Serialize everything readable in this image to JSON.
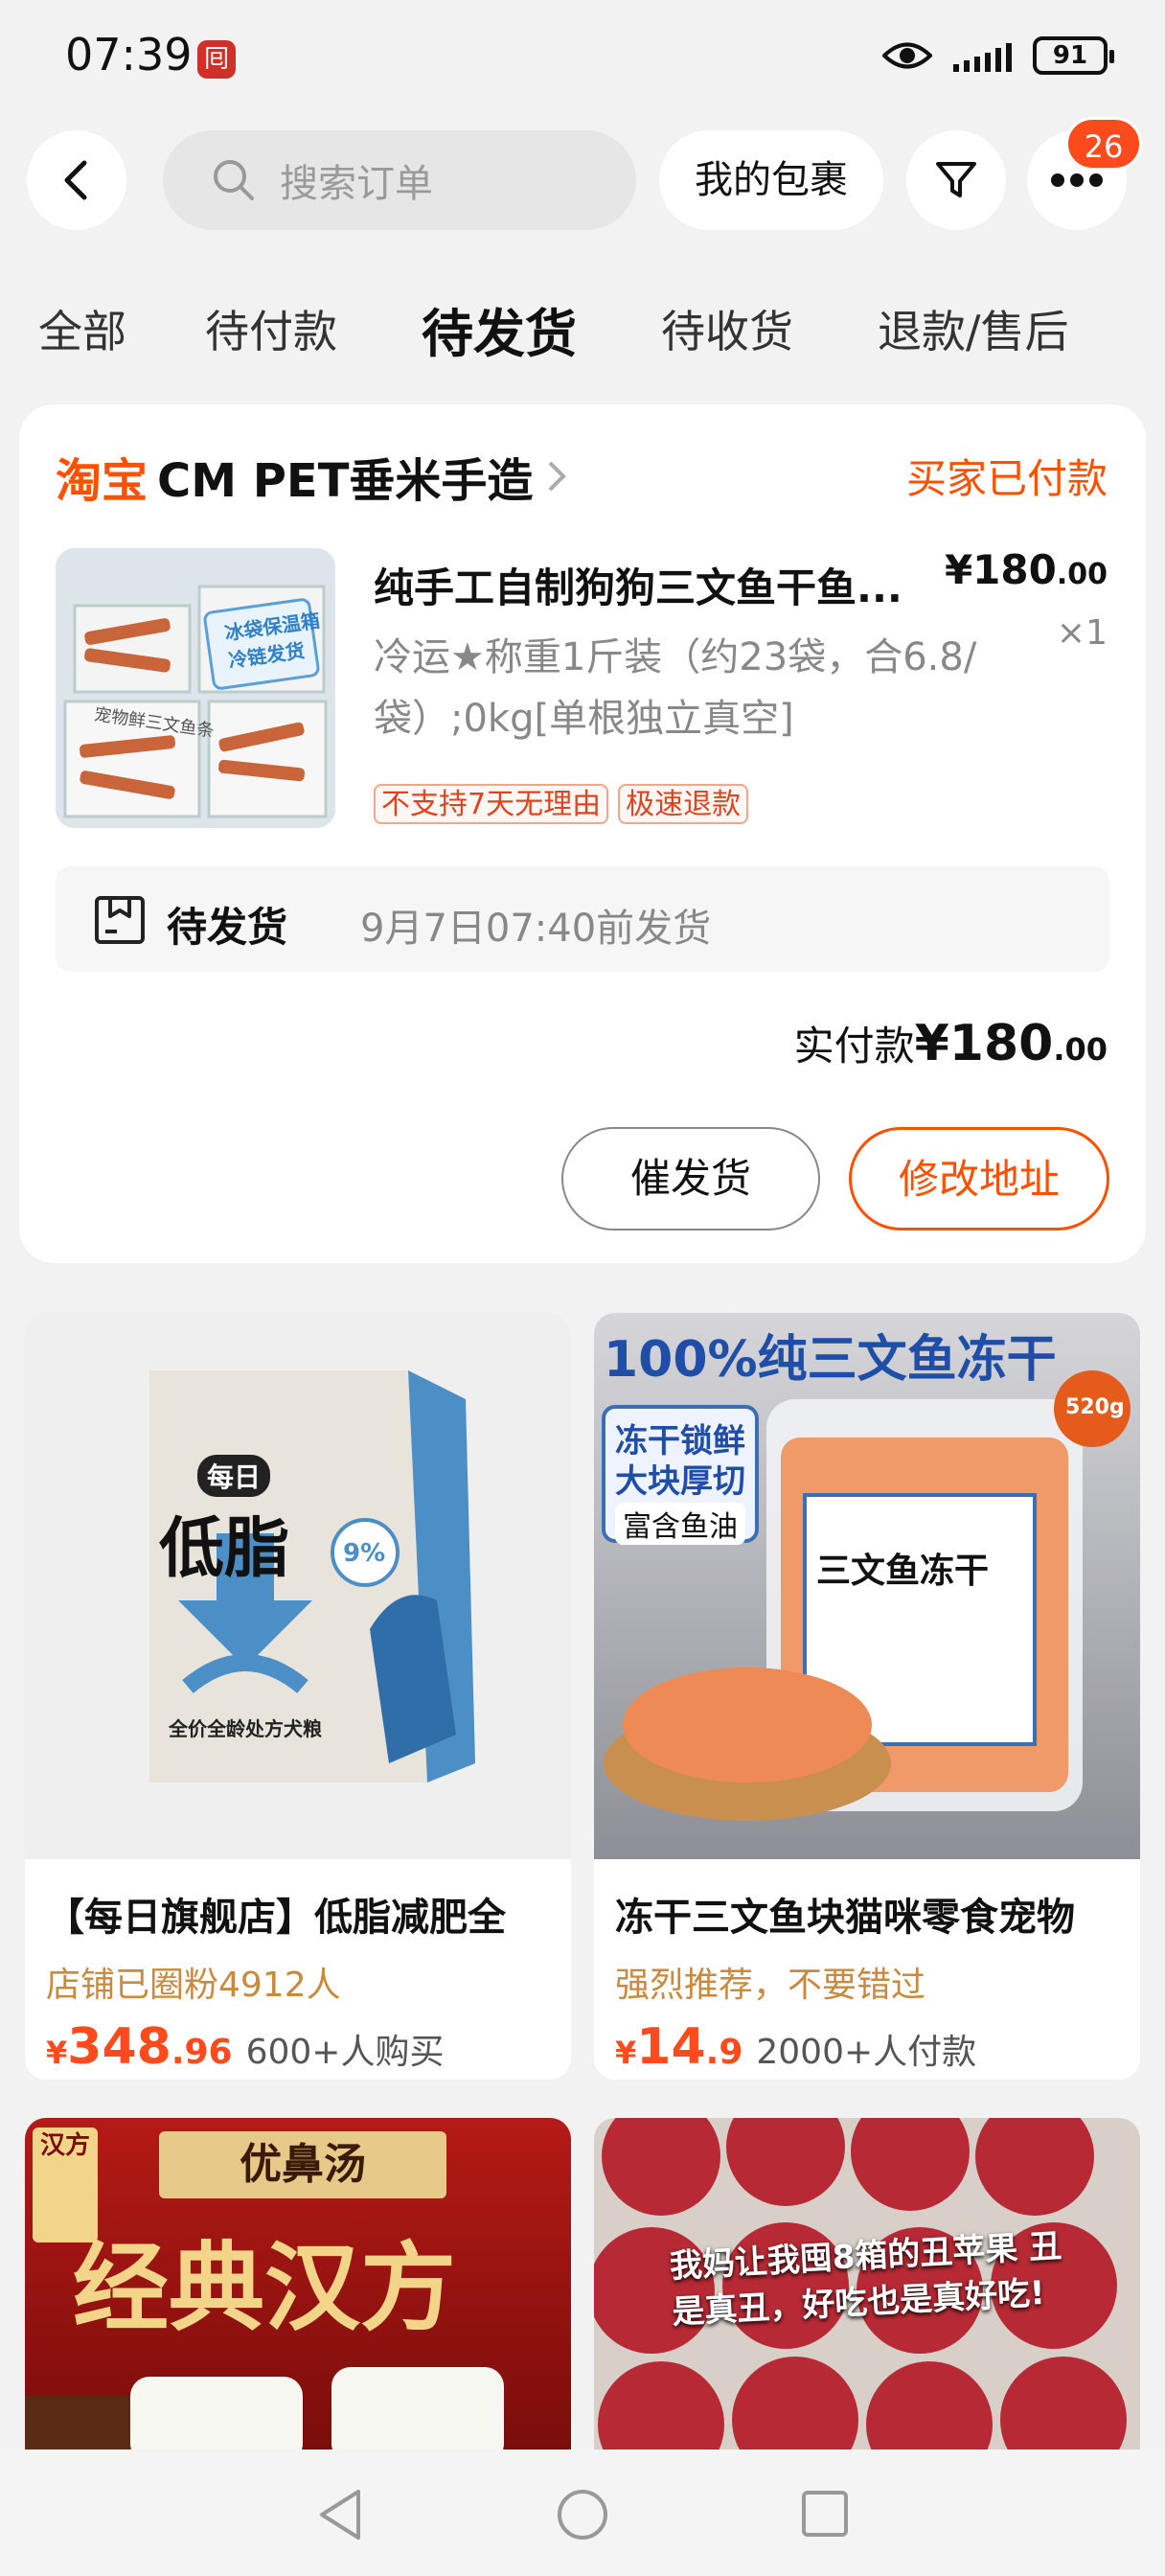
{
  "status_bar": {
    "time": "07:39",
    "app_icon_glyph": "囘",
    "battery": "91"
  },
  "header": {
    "search_placeholder": "搜索订单",
    "package_button": "我的包裹",
    "badge_count": "26"
  },
  "tabs": [
    {
      "label": "全部"
    },
    {
      "label": "待付款"
    },
    {
      "label": "待发货",
      "active": true
    },
    {
      "label": "待收货"
    },
    {
      "label": "退款/售后"
    }
  ],
  "order": {
    "platform": "淘宝",
    "shop_name": "CM PET垂米手造",
    "status": "买家已付款",
    "product_title": "纯手工自制狗狗三文鱼干鱼...",
    "price_int": "¥180",
    "price_dec": ".00",
    "quantity": "×1",
    "spec": "冷运★称重1斤装（约23袋，合6.8/袋）;0kg[单根独立真空]",
    "tags": [
      "不支持7天无理由",
      "极速退款"
    ],
    "image_text_1": "冰袋保温箱",
    "image_text_2": "冷链发货",
    "image_text_3": "宠物鲜三文鱼条",
    "ship_status": "待发货",
    "ship_time": "9月7日07:40前发货",
    "pay_label": "实付款",
    "pay_int": "¥180",
    "pay_dec": ".00",
    "btn_urge": "催发货",
    "btn_address": "修改地址"
  },
  "recommendations": [
    {
      "title": "【每日旗舰店】低脂减肥全",
      "subtitle": "店铺已圈粉4912人",
      "currency": "¥",
      "price_int": "348",
      "price_dec": ".96",
      "sold": "600+人购买",
      "img_brand": "每日",
      "img_main": "低脂",
      "img_pct": "9%",
      "img_caption": "全价全龄处方犬粮"
    },
    {
      "title": "冻干三文鱼块猫咪零食宠物",
      "subtitle": "强烈推荐，不要错过",
      "currency": "¥",
      "price_int": "14",
      "price_dec": ".9",
      "sold": "2000+人付款",
      "img_headline": "100%纯三文鱼冻干",
      "img_box1": "冻干锁鲜",
      "img_box2": "大块厚切",
      "img_box3": "富含鱼油",
      "img_label": "三文鱼冻干",
      "img_sticker": "520g"
    },
    {
      "img_banner": "优鼻汤",
      "img_main": "经典汉方",
      "img_seal": "汉方"
    },
    {
      "img_text": "我妈让我囤8箱的丑苹果 丑是真丑，好吃也是真好吃!"
    }
  ],
  "colors": {
    "accent": "#ff5000",
    "price": "#ff4a1c",
    "badge": "#ff4a1c"
  }
}
